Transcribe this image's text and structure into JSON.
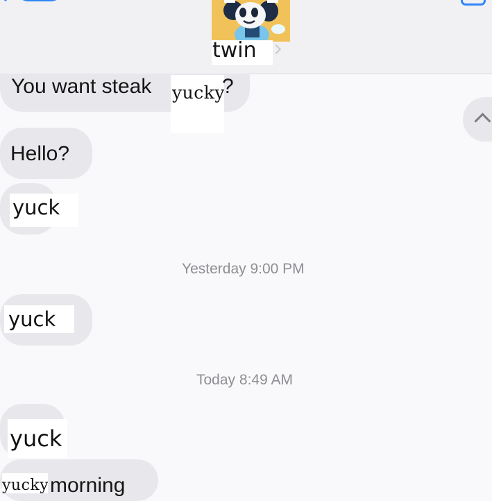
{
  "contact": {
    "name": "twin"
  },
  "messages": [
    {
      "before": "You want steak ",
      "overlay": "yucky",
      "after": "?"
    },
    {
      "text": "Hello?"
    },
    {
      "overlay": "yuck"
    },
    {
      "overlay": "yuck"
    },
    {
      "overlay": "yuck"
    },
    {
      "overlay": "yucky",
      "after": "morning"
    }
  ],
  "timestamps": {
    "yesterday": {
      "day": "Yesterday",
      "time": "9:00 PM"
    },
    "today": {
      "day": "Today",
      "time": "8:49 AM"
    }
  },
  "icons": {
    "back": "chevron-left-icon",
    "video": "video-camera-icon",
    "scroll": "chevron-up-icon"
  },
  "colors": {
    "accent": "#2f86f6",
    "bubble": "#e8e8ec",
    "timestamp": "#8e8e93"
  }
}
